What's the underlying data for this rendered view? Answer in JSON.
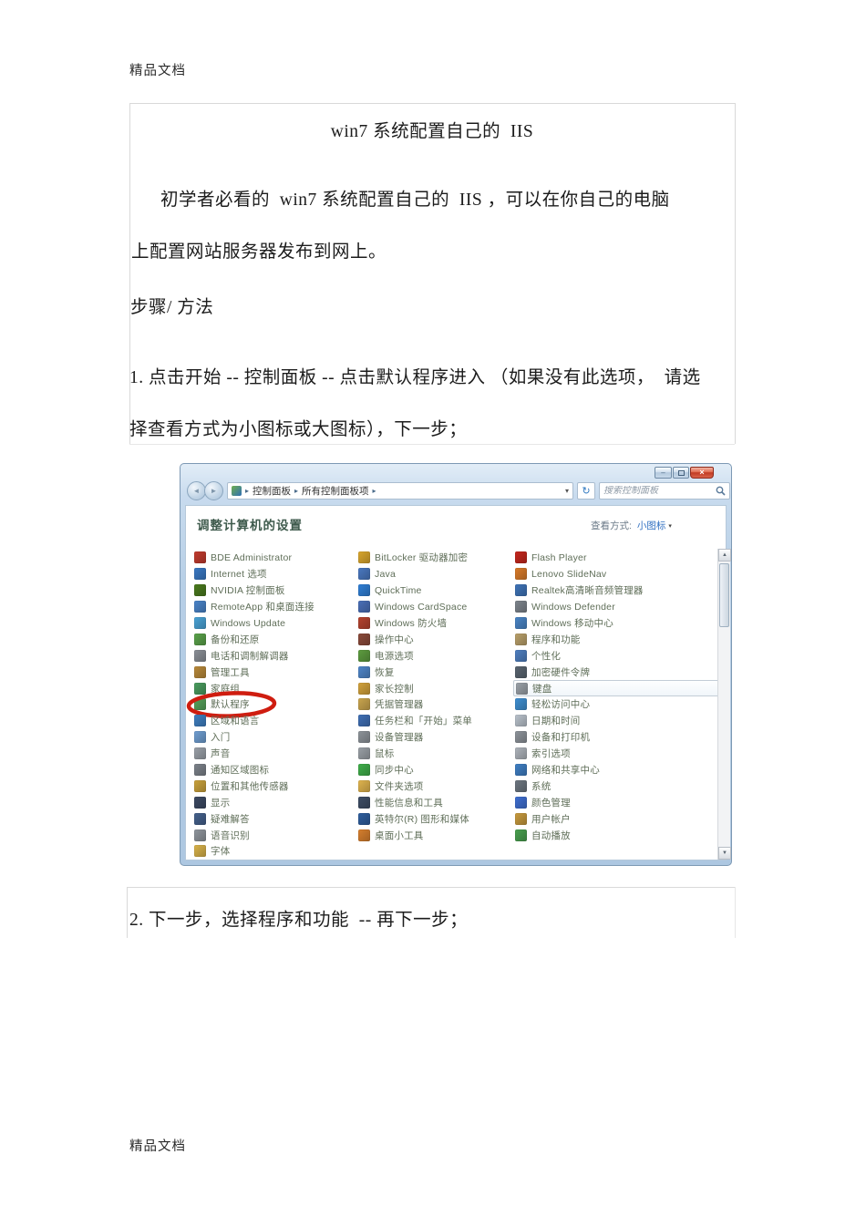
{
  "page": {
    "header_label": "精品文档",
    "footer_label": "精品文档"
  },
  "document": {
    "title": "win7 系统配置自己的  IIS",
    "intro_line1": "初学者必看的  win7 系统配置自己的  IIS ，可以在你自己的电脑",
    "intro_line2": "上配置网站服务器发布到网上。",
    "section_heading": "步骤/ 方法",
    "step1_line1": "1. 点击开始 -- 控制面板 -- 点击默认程序进入 （如果没有此选项，  请选",
    "step1_line2": "择查看方式为小图标或大图标），下一步；",
    "step2": "2. 下一步，选择程序和功能  -- 再下一步；"
  },
  "colors": {
    "annotation_red": "#cf1d10",
    "link_blue": "#2f6fc1",
    "item_text_green": "#5f6e58",
    "heading_green": "#3e5a4c"
  },
  "icons": {
    "back": "◄",
    "forward": "►",
    "breadcrumb_sep": "▸",
    "dropdown": "▾",
    "refresh": "↻",
    "minimize": "–",
    "close": "×",
    "scroll_up": "▲",
    "scroll_down": "▼"
  },
  "screenshot": {
    "breadcrumb": {
      "segments": [
        "控制面板",
        "所有控制面板项"
      ]
    },
    "search_placeholder": "搜索控制面板",
    "heading": "调整计算机的设置",
    "view_label": "查看方式:",
    "view_value": "小图标",
    "columns": [
      {
        "items": [
          {
            "label": "BDE Administrator",
            "icon": "bde-administrator-icon",
            "color": "#c23b2e"
          },
          {
            "label": "Internet 选项",
            "icon": "internet-options-icon",
            "color": "#3a79c4"
          },
          {
            "label": "NVIDIA 控制面板",
            "icon": "nvidia-control-panel-icon",
            "color": "#4a7a1e"
          },
          {
            "label": "RemoteApp 和桌面连接",
            "icon": "remoteapp-icon",
            "color": "#4a84c9"
          },
          {
            "label": "Windows Update",
            "icon": "windows-update-icon",
            "color": "#4aa3d6"
          },
          {
            "label": "备份和还原",
            "icon": "backup-restore-icon",
            "color": "#5aa24a"
          },
          {
            "label": "电话和调制解调器",
            "icon": "phone-modem-icon",
            "color": "#8a8f96"
          },
          {
            "label": "管理工具",
            "icon": "admin-tools-icon",
            "color": "#b8893a"
          },
          {
            "label": "家庭组",
            "icon": "homegroup-icon",
            "color": "#4a9c5f"
          },
          {
            "label": "默认程序",
            "icon": "default-programs-icon",
            "color": "#57a35c",
            "circled": true
          },
          {
            "label": "区域和语言",
            "icon": "region-language-icon",
            "color": "#3f7fc1"
          },
          {
            "label": "入门",
            "icon": "getting-started-icon",
            "color": "#6f9ed1"
          },
          {
            "label": "声音",
            "icon": "sound-icon",
            "color": "#9aa0a8"
          },
          {
            "label": "通知区域图标",
            "icon": "notification-area-icons-icon",
            "color": "#7c828a"
          },
          {
            "label": "位置和其他传感器",
            "icon": "location-sensors-icon",
            "color": "#caa23c"
          },
          {
            "label": "显示",
            "icon": "display-icon",
            "color": "#3c4a63"
          },
          {
            "label": "疑难解答",
            "icon": "troubleshooting-icon",
            "color": "#45618c"
          },
          {
            "label": "语音识别",
            "icon": "speech-recognition-icon",
            "color": "#8f959c"
          },
          {
            "label": "字体",
            "icon": "fonts-icon",
            "color": "#d8b24a"
          }
        ]
      },
      {
        "items": [
          {
            "label": "BitLocker 驱动器加密",
            "icon": "bitlocker-icon",
            "color": "#d9a62e"
          },
          {
            "label": "Java",
            "icon": "java-icon",
            "color": "#4a78c0"
          },
          {
            "label": "QuickTime",
            "icon": "quicktime-icon",
            "color": "#2f7fd6"
          },
          {
            "label": "Windows CardSpace",
            "icon": "cardspace-icon",
            "color": "#4a6fb8"
          },
          {
            "label": "Windows 防火墙",
            "icon": "windows-firewall-icon",
            "color": "#b5432f"
          },
          {
            "label": "操作中心",
            "icon": "action-center-icon",
            "color": "#8a4a3a"
          },
          {
            "label": "电源选项",
            "icon": "power-options-icon",
            "color": "#5d9c3f"
          },
          {
            "label": "恢复",
            "icon": "recovery-icon",
            "color": "#4f86c9"
          },
          {
            "label": "家长控制",
            "icon": "parental-controls-icon",
            "color": "#d2a23c"
          },
          {
            "label": "凭据管理器",
            "icon": "credential-manager-icon",
            "color": "#caa54e"
          },
          {
            "label": "任务栏和「开始」菜单",
            "icon": "taskbar-start-menu-icon",
            "color": "#3f6fb5"
          },
          {
            "label": "设备管理器",
            "icon": "device-manager-icon",
            "color": "#8d9399"
          },
          {
            "label": "鼠标",
            "icon": "mouse-icon",
            "color": "#9aa0a6"
          },
          {
            "label": "同步中心",
            "icon": "sync-center-icon",
            "color": "#3fae4a"
          },
          {
            "label": "文件夹选项",
            "icon": "folder-options-icon",
            "color": "#e0b44e"
          },
          {
            "label": "性能信息和工具",
            "icon": "performance-tools-icon",
            "color": "#3e4e66"
          },
          {
            "label": "英特尔(R) 图形和媒体",
            "icon": "intel-graphics-media-icon",
            "color": "#2f5e9e"
          },
          {
            "label": "桌面小工具",
            "icon": "desktop-gadgets-icon",
            "color": "#d77f2e"
          }
        ]
      },
      {
        "items": [
          {
            "label": "Flash Player",
            "icon": "flash-player-icon",
            "color": "#c5271d"
          },
          {
            "label": "Lenovo SlideNav",
            "icon": "lenovo-slidenav-icon",
            "color": "#d97b2a"
          },
          {
            "label": "Realtek高清晰音频管理器",
            "icon": "realtek-audio-icon",
            "color": "#3f74b8"
          },
          {
            "label": "Windows Defender",
            "icon": "windows-defender-icon",
            "color": "#7d848c"
          },
          {
            "label": "Windows 移动中心",
            "icon": "mobility-center-icon",
            "color": "#4a85c6"
          },
          {
            "label": "程序和功能",
            "icon": "programs-features-icon",
            "color": "#b9a06a"
          },
          {
            "label": "个性化",
            "icon": "personalization-icon",
            "color": "#4f7fc0"
          },
          {
            "label": "加密硬件令牌",
            "icon": "encryption-hardware-token-icon",
            "color": "#5a6570"
          },
          {
            "label": "键盘",
            "icon": "keyboard-icon",
            "color": "#9aa1a8",
            "highlighted": true
          },
          {
            "label": "轻松访问中心",
            "icon": "ease-of-access-icon",
            "color": "#3f8fd1"
          },
          {
            "label": "日期和时间",
            "icon": "date-time-icon",
            "color": "#b9c2cc"
          },
          {
            "label": "设备和打印机",
            "icon": "devices-printers-icon",
            "color": "#8d939a"
          },
          {
            "label": "索引选项",
            "icon": "indexing-options-icon",
            "color": "#aeb4bb"
          },
          {
            "label": "网络和共享中心",
            "icon": "network-sharing-center-icon",
            "color": "#3f7fc4"
          },
          {
            "label": "系统",
            "icon": "system-icon",
            "color": "#6d7680"
          },
          {
            "label": "颜色管理",
            "icon": "color-management-icon",
            "color": "#3f6fd1"
          },
          {
            "label": "用户帐户",
            "icon": "user-accounts-icon",
            "color": "#c79a3e"
          },
          {
            "label": "自动播放",
            "icon": "autoplay-icon",
            "color": "#49a04f"
          }
        ]
      }
    ]
  }
}
